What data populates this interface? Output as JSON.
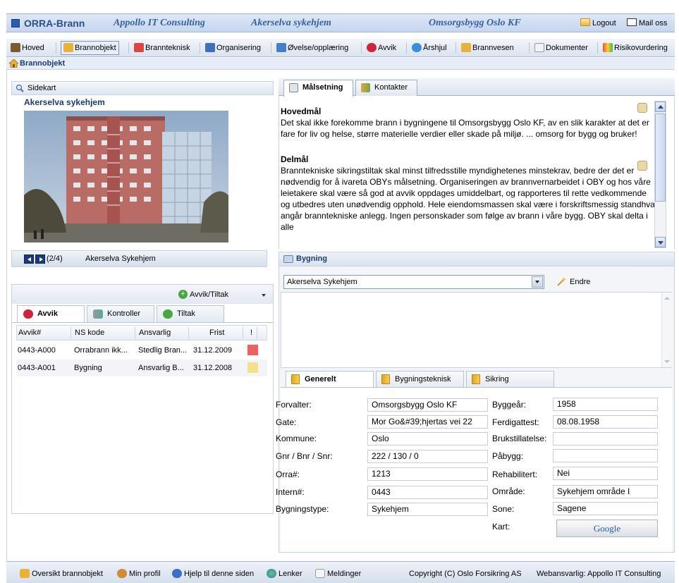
{
  "header": {
    "app_name": "ORRA-Brann",
    "company": "Appollo IT Consulting",
    "site": "Akerselva sykehjem",
    "owner": "Omsorgsbygg Oslo KF",
    "logout": "Logout",
    "mail": "Mail oss"
  },
  "nav": {
    "tabs": [
      "Hoved",
      "Brannobjekt",
      "Brannteknisk",
      "Organisering",
      "Øvelse/opplæring",
      "Avvik",
      "Årshjul",
      "Brannvesen",
      "Dokumenter",
      "Risikovurdering"
    ],
    "active": "Brannobjekt"
  },
  "breadcrumb": "Brannobjekt",
  "left": {
    "map_link": "Sidekart",
    "object_title": "Akerselva sykehjem",
    "photo_counter": "(2/4)",
    "photo_name": "Akerselva Sykehjem",
    "add_menu": "Avvik/Tiltak",
    "tabs": [
      "Avvik",
      "Kontroller",
      "Tiltak"
    ],
    "grid": {
      "columns": [
        "Avvik#",
        "NS kode",
        "Ansvarlig",
        "Frist",
        "!"
      ],
      "rows": [
        {
          "id": "0443-A000",
          "ns": "Orrabrann ikk...",
          "ansvarlig": "Stedlig Bran...",
          "frist": "31.12.2009",
          "flag_color": "#f06060"
        },
        {
          "id": "0443-A001",
          "ns": "Bygning",
          "ansvarlig": "Ansvarlig B...",
          "frist": "31.12.2008",
          "flag_color": "#f5e08a"
        }
      ]
    }
  },
  "right": {
    "tabs": [
      "Målsetning",
      "Kontakter"
    ],
    "goals": {
      "main_title": "Hovedmål",
      "main_text": "Det skal ikke forekomme brann i bygningene til Omsorgsbygg Oslo KF, av en slik karakter at det er fare for liv og helse, større materielle verdier eller skade på miljø. ... omsorg for bygg og bruker!",
      "sub_title": "Delmål",
      "sub_text": "Branntekniske sikringstiltak skal minst tilfredsstille myndighetenes minstekrav, bedre der det er nødvendig for å ivareta OBYs målsetning. Organiseringen av brannvernarbeidet i OBY og hos våre leietakere skal være så god at avvik oppdages umiddelbart, og rapporteres til rette vedkommende og utbedres uten unødvendig opphold. Hele eiendomsmassen skal være i forskriftsmessig standhva angår branntekniske anlegg. Ingen personskader som følge av brann i våre bygg. OBY skal delta i alle"
    },
    "building": {
      "heading": "Bygning",
      "selected": "Akerselva Sykehjem",
      "edit": "Endre",
      "tabs": [
        "Generelt",
        "Bygningsteknisk",
        "Sikring"
      ],
      "fields_left": [
        {
          "label": "Forvalter:",
          "value": "Omsorgsbygg Oslo KF"
        },
        {
          "label": "Gate:",
          "value": "Mor Go&#39;hjertas vei 22"
        },
        {
          "label": "Kommune:",
          "value": "Oslo"
        },
        {
          "label": "Gnr / Bnr / Snr:",
          "value": "222 / 130 / 0"
        },
        {
          "label": "Orra#:",
          "value": "1213"
        },
        {
          "label": "Intern#:",
          "value": "0443"
        },
        {
          "label": "Bygningstype:",
          "value": "Sykehjem"
        }
      ],
      "fields_right": [
        {
          "label": "Byggeår:",
          "value": "1958"
        },
        {
          "label": "Ferdigattest:",
          "value": "08.08.1958"
        },
        {
          "label": "Brukstillatelse:",
          "value": ""
        },
        {
          "label": "Påbygg:",
          "value": ""
        },
        {
          "label": "Rehabilitert:",
          "value": "Nei"
        },
        {
          "label": "Område:",
          "value": "Sykehjem område I"
        },
        {
          "label": "Sone:",
          "value": "Sagene"
        }
      ],
      "map_label": "Kart:",
      "map_button": "Google"
    }
  },
  "footer": {
    "links": [
      "Oversikt brannobjekt",
      "Min profil",
      "Hjelp til denne siden",
      "Lenker",
      "Meldinger"
    ],
    "copyright": "Copyright (C) Oslo Forsikring AS",
    "webmaster": "Webansvarlig: Appollo IT Consulting"
  }
}
